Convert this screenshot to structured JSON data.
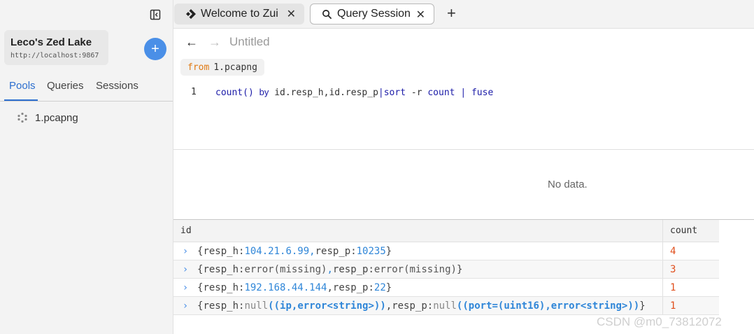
{
  "sidebar": {
    "lake": {
      "name": "Leco's Zed Lake",
      "url": "http://localhost:9867"
    },
    "add_label": "+",
    "tabs": [
      {
        "label": "Pools",
        "active": true
      },
      {
        "label": "Queries",
        "active": false
      },
      {
        "label": "Sessions",
        "active": false
      }
    ],
    "pools": [
      {
        "name": "1.pcapng"
      }
    ]
  },
  "tabs": [
    {
      "label": "Welcome to Zui",
      "icon": "zui-logo-icon"
    },
    {
      "label": "Query Session",
      "icon": "search-icon",
      "active": true
    }
  ],
  "query": {
    "title": "Untitled",
    "from_keyword": "from",
    "from_pool": "1.pcapng",
    "line_number": "1",
    "code": {
      "fn": "count()",
      "by": "by",
      "fields": "id.resp_h,id.resp_p",
      "pipe1": "|",
      "sort": "sort",
      "flag": "-r",
      "sort_field": "count",
      "pipe2": "|",
      "fuse": "fuse"
    }
  },
  "chart_area": {
    "empty_text": "No data."
  },
  "results": {
    "columns": [
      "id",
      "count"
    ],
    "rows": [
      {
        "open": "{",
        "k1": "resp_h",
        "colon1": ": ",
        "v1": "104.21.6.99",
        "sep": ", ",
        "k2": "resp_p",
        "colon2": ": ",
        "v2": "10235",
        "close": "}",
        "count": "4"
      },
      {
        "open": "{",
        "k1": "resp_h",
        "colon1": ": ",
        "v1": "error(missing)",
        "sep": ", ",
        "k2": "resp_p",
        "colon2": ": ",
        "v2": "error(missing)",
        "close": "}",
        "count": "3"
      },
      {
        "open": "{",
        "k1": "resp_h",
        "colon1": ": ",
        "v1": "192.168.44.144",
        "sep": ", ",
        "k2": "resp_p",
        "colon2": ": ",
        "v2": "22",
        "close": "}",
        "count": "1"
      },
      {
        "open": "{",
        "k1": "resp_h",
        "colon1": ": ",
        "v1a": "null ",
        "v1b": "((ip,error<string>))",
        "sep": ", ",
        "k2": "resp_p",
        "colon2": ": ",
        "v2a": "null ",
        "v2b": "((port=(uint16),error<string>))",
        "close": "}",
        "count": "1"
      }
    ]
  },
  "watermark": "CSDN @m0_73812072",
  "colors": {
    "accent": "#4a8fe7",
    "active_tab": "#2d6fcf",
    "count": "#e0501e",
    "keyword": "#e07a14"
  }
}
